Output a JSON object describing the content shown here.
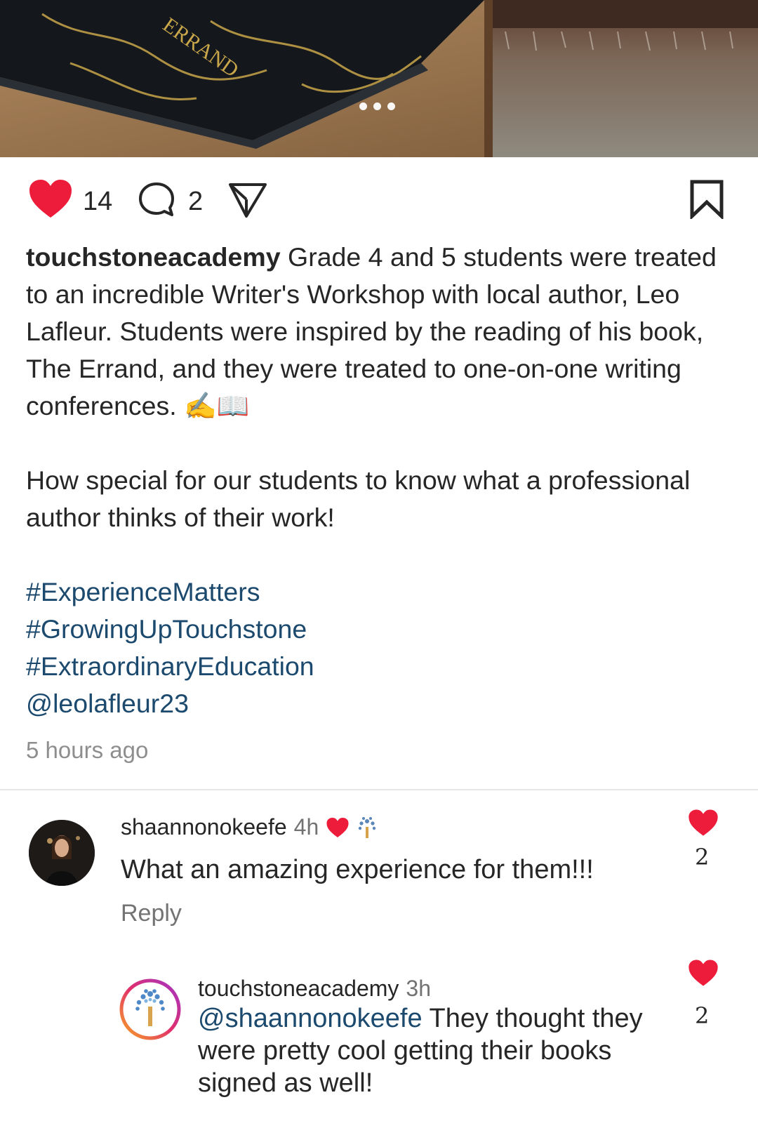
{
  "post": {
    "image_dots": 3,
    "likes": "14",
    "comments": "2",
    "username": "touchstoneacademy",
    "caption_p1": "Grade 4 and 5 students were treated to an incredible Writer's Workshop with local author, Leo Lafleur. Students were inspired by the reading of his book, The Errand, and they were treated to one-on-one writing conferences.",
    "caption_emoji": "✍📖",
    "caption_p2": "How special for our students to know what a professional author thinks of their work!",
    "hashtags": [
      "#ExperienceMatters",
      "#GrowingUpTouchstone",
      "#ExtraordinaryEducation"
    ],
    "mention": "@leolafleur23",
    "time_ago": "5 hours ago"
  },
  "comments": [
    {
      "username": "shaannonokeefe",
      "time": "4h",
      "text": "What an amazing experience for them!!!",
      "likes": "2",
      "reply_label": "Reply"
    },
    {
      "username": "touchstoneacademy",
      "time": "3h",
      "mention": "@shaannonokeefe",
      "text": " They thought they were pretty cool getting their books signed as well!",
      "likes": "2"
    }
  ],
  "colors": {
    "heart": "#ed1c3a",
    "link": "#1c4a6e",
    "muted": "#8e8e8e"
  },
  "icons": [
    "heart-icon",
    "comment-icon",
    "share-icon",
    "bookmark-icon",
    "tree-logo-icon"
  ]
}
